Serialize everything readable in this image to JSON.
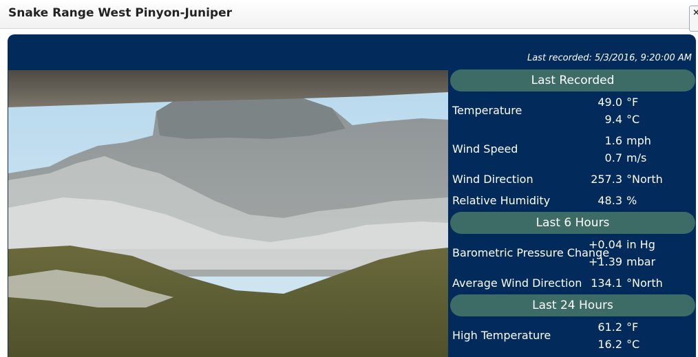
{
  "window": {
    "title": "Snake Range West Pinyon-Juniper",
    "close_symbol": "×"
  },
  "panel": {
    "last_recorded": "Last recorded: 5/3/2016, 9:20:00 AM"
  },
  "sections": {
    "last_recorded": {
      "title": "Last Recorded",
      "temperature": {
        "label": "Temperature",
        "v1": "49.0",
        "u1": "°F",
        "v2": "9.4",
        "u2": "°C"
      },
      "wind_speed": {
        "label": "Wind Speed",
        "v1": "1.6",
        "u1": "mph",
        "v2": "0.7",
        "u2": "m/s"
      },
      "wind_direction": {
        "label": "Wind Direction",
        "v1": "257.3",
        "u1": "°North"
      },
      "humidity": {
        "label": "Relative Humidity",
        "v1": "48.3",
        "u1": "%"
      }
    },
    "last_6_hours": {
      "title": "Last 6 Hours",
      "pressure_change": {
        "label": "Barometric Pressure Change",
        "v1": "+0.04",
        "u1": "in Hg",
        "v2": "+1.39",
        "u2": "mbar"
      },
      "avg_wind_direction": {
        "label": "Average Wind Direction",
        "v1": "134.1",
        "u1": "°North"
      }
    },
    "last_24_hours": {
      "title": "Last 24 Hours",
      "high_temperature": {
        "label": "High Temperature",
        "v1": "61.2",
        "u1": "°F",
        "v2": "16.2",
        "u2": "°C"
      }
    }
  },
  "colors": {
    "panel_bg": "#022b5c",
    "section_header_bg": "#3d6b65",
    "text": "#ffffff"
  }
}
